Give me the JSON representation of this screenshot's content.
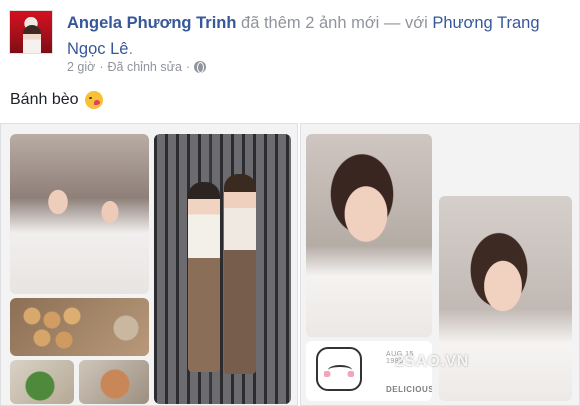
{
  "post": {
    "author": "Angela Phương Trinh",
    "action": " đã thêm 2 ảnh mới — với ",
    "tagged": "Phương Trang Ngọc Lê",
    "period": ".",
    "time": "2 giờ",
    "separator": "·",
    "edited": "Đã chỉnh sửa",
    "caption": "Bánh bèo"
  },
  "icons": {
    "privacy": "globe-icon",
    "emoji": "kissing-face-emoji-icon"
  },
  "photos": {
    "sticker_date": "AUG 15 1983",
    "sticker_text": "DELICIOUS!",
    "watermark": "2SAO.VN"
  },
  "colors": {
    "link": "#365899",
    "muted": "#90949c",
    "text": "#1d2129"
  }
}
